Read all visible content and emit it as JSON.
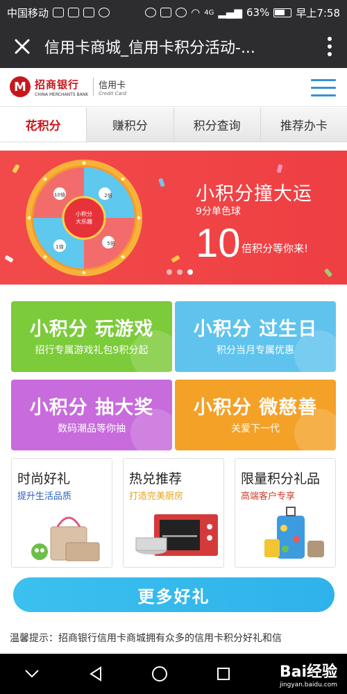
{
  "status_bar": {
    "carrier": "中国移动",
    "signal": "4G",
    "battery": "63%",
    "time": "早上7:58"
  },
  "browser": {
    "page_title": "信用卡商城_信用卡积分活动-...",
    "close_icon": "close-icon",
    "more_icon": "more-vertical-icon"
  },
  "header": {
    "bank_name": "招商银行",
    "bank_en": "CHINA MERCHANTS BANK",
    "card_label": "信用卡",
    "card_en": "Credit Card",
    "menu_icon": "hamburger-icon"
  },
  "tabs": [
    {
      "label": "花积分",
      "active": true
    },
    {
      "label": "赚积分",
      "active": false
    },
    {
      "label": "积分查询",
      "active": false
    },
    {
      "label": "推荐办卡",
      "active": false
    }
  ],
  "banner": {
    "title": "小积分撞大运",
    "subtitle": "9分单色球",
    "big_number": "10",
    "small_text": "倍积分等你来!",
    "wheel_center": "小积分\n大乐趣",
    "wheel_segments": [
      "2倍",
      "5倍",
      "1倍",
      "10倍"
    ],
    "slide_count": 4,
    "active_slide": 3
  },
  "tiles": [
    {
      "title": "小积分 玩游戏",
      "subtitle": "招行专属游戏礼包9积分起",
      "color": "#7ccb3a"
    },
    {
      "title": "小积分 过生日",
      "subtitle": "积分当月专属优惠",
      "color": "#5fc3ee"
    },
    {
      "title": "小积分 抽大奖",
      "subtitle": "数码潮品等你抽",
      "color": "#c86bdc"
    },
    {
      "title": "小积分 微慈善",
      "subtitle": "关爱下一代",
      "color": "#f4a128"
    }
  ],
  "products": [
    {
      "title": "时尚好礼",
      "subtitle": "提升生活品质",
      "sub_color": "#2a5fc0"
    },
    {
      "title": "热兑推荐",
      "subtitle": "打造完美厨房",
      "sub_color": "#e8a21a"
    },
    {
      "title": "限量积分礼品",
      "subtitle": "高端客户专享",
      "sub_color": "#d33a2c"
    }
  ],
  "more_button": "更多好礼",
  "tip_text": "温馨提示：招商银行信用卡商城拥有众多的信用卡积分好礼和信",
  "watermark": {
    "brand": "Bai经验",
    "url": "jingyan.baidu.com"
  },
  "nav": {
    "back_icon": "back-icon",
    "home_icon": "home-icon",
    "recent_icon": "recent-apps-icon",
    "down_icon": "chevron-down-icon"
  }
}
